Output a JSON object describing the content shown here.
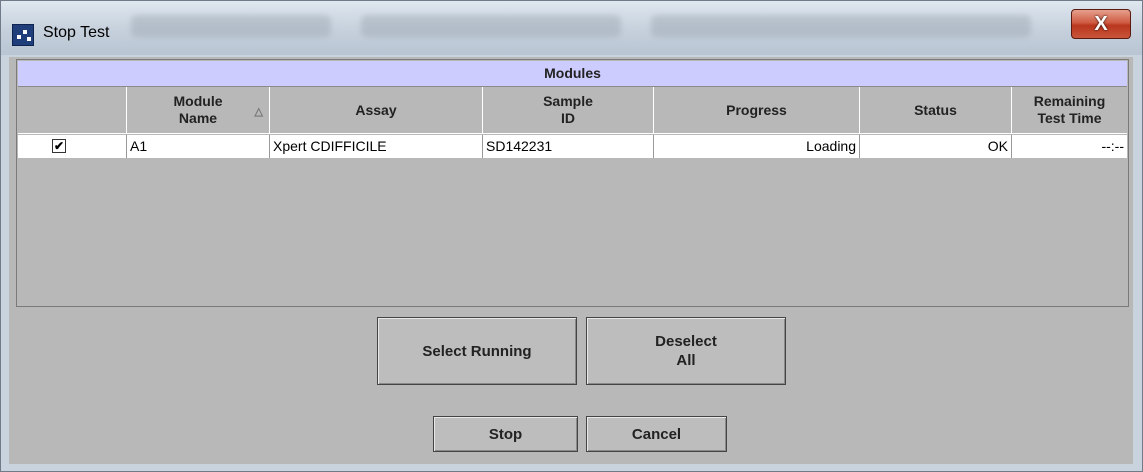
{
  "window": {
    "title": "Stop Test",
    "close_label": "X"
  },
  "table": {
    "section_title": "Modules",
    "columns": [
      {
        "label": ""
      },
      {
        "label": "Module\nName"
      },
      {
        "label": "Assay"
      },
      {
        "label": "Sample\nID"
      },
      {
        "label": "Progress"
      },
      {
        "label": "Status"
      },
      {
        "label": "Remaining\nTest Time"
      }
    ],
    "rows": [
      {
        "checked": true,
        "check_mark": "✔",
        "module_name": "A1",
        "assay": "Xpert CDIFFICILE",
        "sample_id": "SD142231",
        "progress": "Loading",
        "status": "OK",
        "remaining": "--:--"
      }
    ]
  },
  "buttons": {
    "select_running": "Select Running",
    "deselect_all": "Deselect\nAll",
    "stop": "Stop",
    "cancel": "Cancel"
  },
  "colors": {
    "header_band": "#ccccff",
    "close_button": "#c9553a"
  }
}
